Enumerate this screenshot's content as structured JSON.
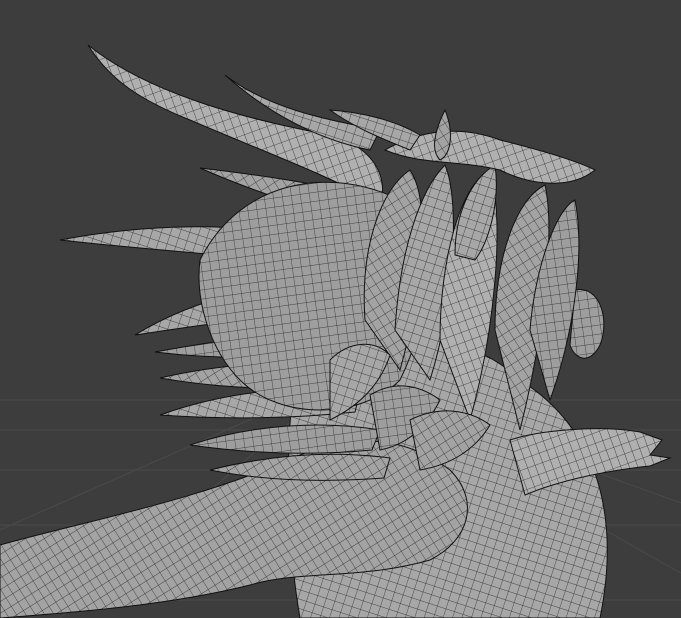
{
  "viewport": {
    "mode": "3d-viewport",
    "shading": "solid-wireframe",
    "background_color": "#3d3d3d",
    "grid_color": "#4a4a4a",
    "mesh_color": "#a9a9a9",
    "wire_color": "#1a1a1a"
  }
}
